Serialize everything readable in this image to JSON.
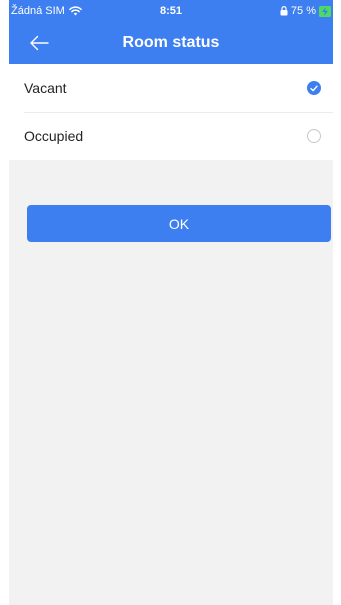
{
  "status_bar": {
    "carrier": "Žádná SIM",
    "time": "8:51",
    "battery": "75 %"
  },
  "header": {
    "title": "Room status"
  },
  "options": [
    {
      "label": "Vacant",
      "selected": true
    },
    {
      "label": "Occupied",
      "selected": false
    }
  ],
  "actions": {
    "ok_label": "OK"
  },
  "colors": {
    "accent": "#3d7ff0",
    "background": "#f2f2f2"
  }
}
